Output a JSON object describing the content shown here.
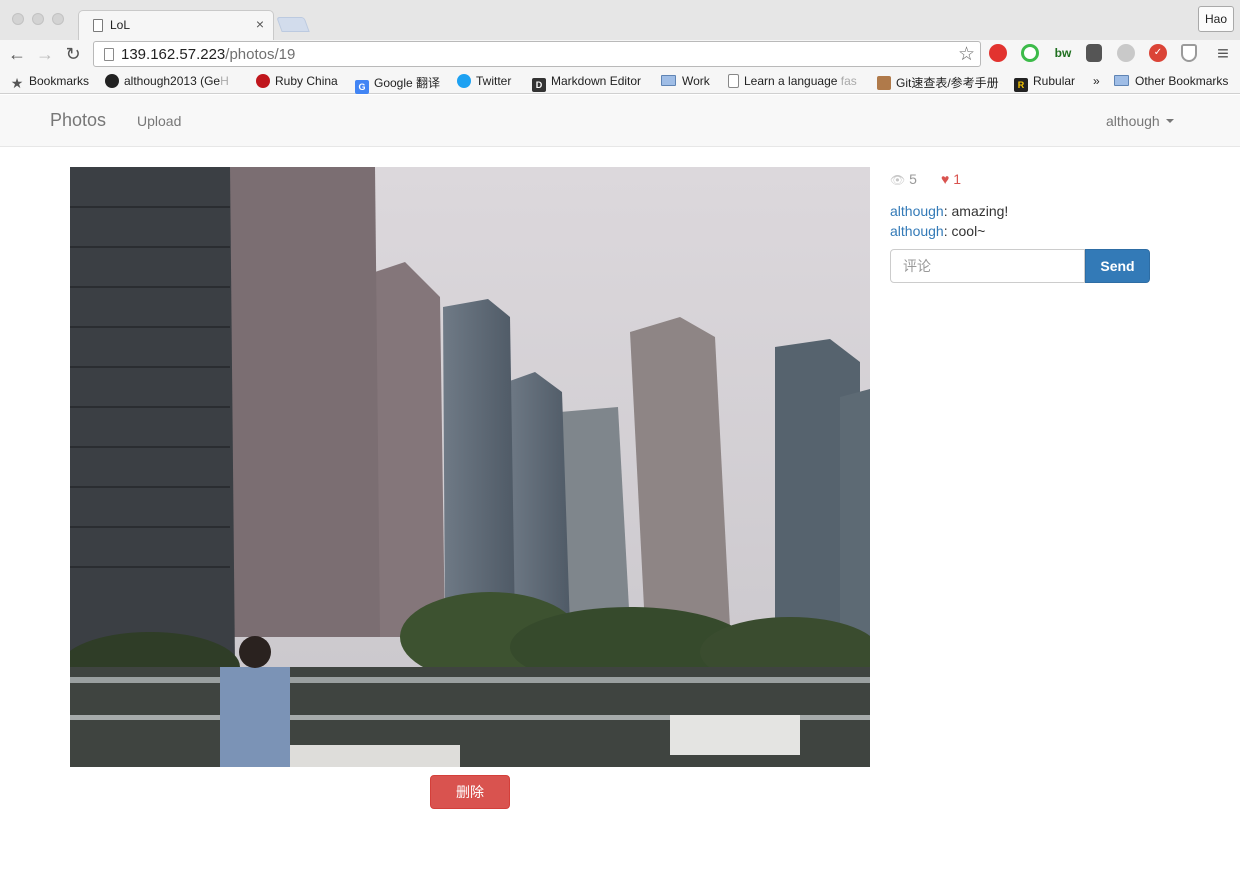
{
  "browser": {
    "tab_title": "LoL",
    "tab_close": "×",
    "profile_name": "Hao",
    "url_host": "139.162.57.223",
    "url_path": "/photos/19",
    "nav_back": "←",
    "nav_forward": "→",
    "nav_reload": "↻",
    "menu": "≡",
    "star": "☆",
    "extensions": [
      {
        "label": "",
        "color": "#e2332f",
        "icon": "stop-icon"
      },
      {
        "label": "",
        "color": "#3dbb4a",
        "icon": "circle-icon"
      },
      {
        "label": "bw",
        "color": "#1f6f1f",
        "icon": "bw-icon"
      },
      {
        "label": "",
        "color": "#555555",
        "icon": "evernote-icon"
      },
      {
        "label": "",
        "color": "#bbbbbb",
        "icon": "check-icon"
      },
      {
        "label": "✓",
        "color": "#db4437",
        "icon": "todoist-icon"
      },
      {
        "label": "",
        "color": "#9a9a9a",
        "icon": "shield-icon"
      }
    ]
  },
  "bookmarks": {
    "items": [
      {
        "label": "Bookmarks",
        "icon": "star-icon"
      },
      {
        "label": "although2013 (Ge",
        "faded": "H",
        "icon": "github-icon"
      },
      {
        "label": "Ruby China",
        "icon": "ruby-icon"
      },
      {
        "label": "Google 翻译",
        "icon": "google-translate-icon"
      },
      {
        "label": "Twitter",
        "icon": "twitter-icon"
      },
      {
        "label": "Markdown Editor",
        "icon": "markdown-icon"
      },
      {
        "label": "Work",
        "icon": "folder-icon"
      },
      {
        "label": "Learn a language",
        "faded": " fas",
        "icon": "page-icon"
      },
      {
        "label": "Git速查表/参考手册",
        "icon": "avatar-icon"
      },
      {
        "label": "Rubular",
        "icon": "rubular-icon"
      },
      {
        "label": "»",
        "icon": "more-icon"
      },
      {
        "label": "Other Bookmarks",
        "icon": "folder-icon"
      }
    ]
  },
  "navbar": {
    "brand": "Photos",
    "upload": "Upload",
    "user": "although"
  },
  "photo": {
    "delete_label": "删除"
  },
  "stats": {
    "views": "5",
    "likes": "1",
    "eye_glyph": "👁",
    "heart_glyph": "♥"
  },
  "comments": [
    {
      "author": "although",
      "text": ": amazing!"
    },
    {
      "author": "although",
      "text": ": cool~"
    }
  ],
  "comment_form": {
    "placeholder": "评论",
    "send_label": "Send"
  },
  "colors": {
    "primary": "#337ab7",
    "danger": "#d9534f",
    "like": "#d9534f"
  }
}
